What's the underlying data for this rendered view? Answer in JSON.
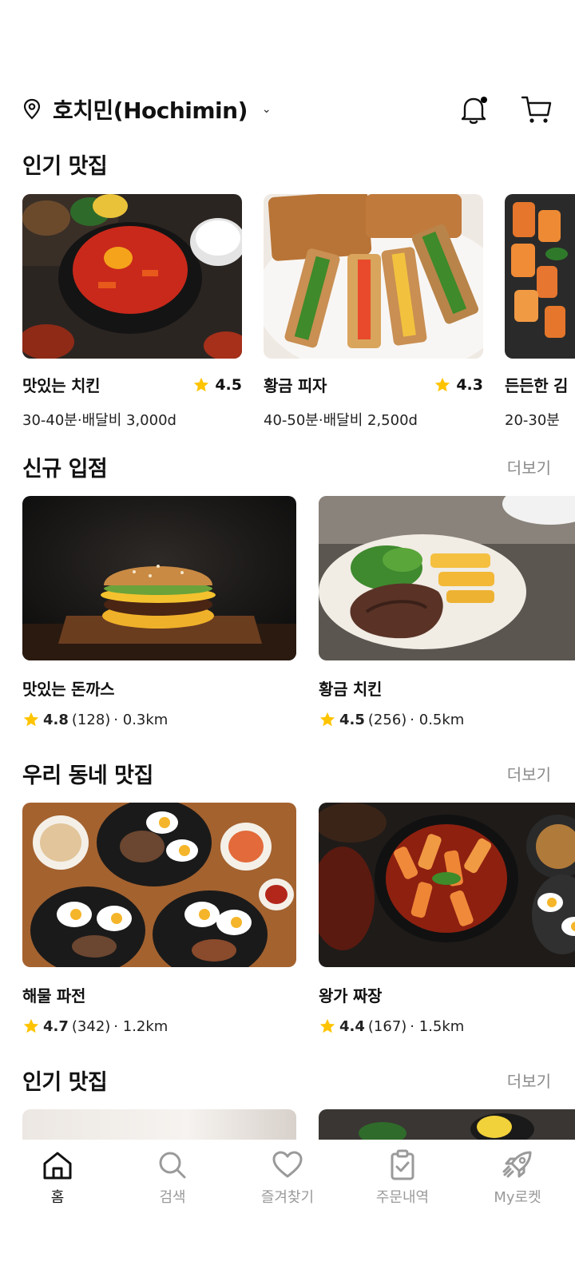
{
  "header": {
    "location": "호치민(Hochimin)",
    "chevron": "⌄",
    "icons": [
      "location-pin-icon",
      "bell-icon",
      "cart-icon"
    ]
  },
  "sections": {
    "popular": {
      "title": "인기 맛집"
    },
    "new": {
      "title": "신규 입점",
      "more": "더보기"
    },
    "local": {
      "title": "우리 동네 맛집",
      "more": "더보기"
    },
    "popular2": {
      "title": "인기 맛집",
      "more": "더보기"
    }
  },
  "popular_cards": [
    {
      "name": "맛있는 치킨",
      "rating": "4.5",
      "sub": "30-40분·배달비 3,000d"
    },
    {
      "name": "황금 피자",
      "rating": "4.3",
      "sub": "40-50분·배달비 2,500d"
    },
    {
      "name": "든든한 김",
      "rating": "",
      "sub": "20-30분"
    }
  ],
  "new_cards": [
    {
      "name": "맛있는 돈까스",
      "rating": "4.8",
      "reviews": "(128)",
      "distance": "· 0.3km"
    },
    {
      "name": "황금 치킨",
      "rating": "4.5",
      "reviews": "(256)",
      "distance": "· 0.5km"
    }
  ],
  "local_cards": [
    {
      "name": "해물 파전",
      "rating": "4.7",
      "reviews": "(342)",
      "distance": "· 1.2km"
    },
    {
      "name": "왕가 짜장",
      "rating": "4.4",
      "reviews": "(167)",
      "distance": "· 1.5km"
    }
  ],
  "nav": [
    {
      "label": "홈",
      "icon": "home-icon",
      "active": true
    },
    {
      "label": "검색",
      "icon": "search-icon",
      "active": false
    },
    {
      "label": "즐겨찾기",
      "icon": "heart-icon",
      "active": false
    },
    {
      "label": "주문내역",
      "icon": "clipboard-icon",
      "active": false
    },
    {
      "label": "My로켓",
      "icon": "rocket-icon",
      "active": false
    }
  ],
  "colors": {
    "star": "#FFC400",
    "muted": "#8a8a8a",
    "text": "#111111"
  }
}
